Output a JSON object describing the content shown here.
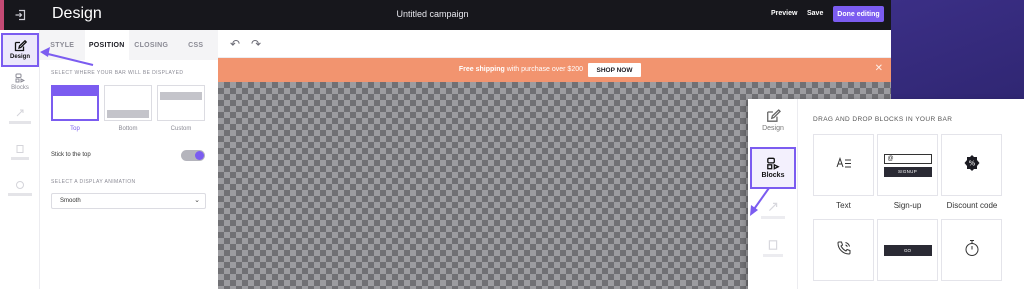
{
  "header": {
    "title": "Design",
    "campaign_name": "Untitled campaign",
    "preview_label": "Preview",
    "save_label": "Save",
    "done_label": "Done editing"
  },
  "left_rail": {
    "items": [
      {
        "label": "Design",
        "icon": "edit-icon",
        "active": true
      },
      {
        "label": "Blocks",
        "icon": "blocks-icon",
        "active": false
      }
    ]
  },
  "panel": {
    "tabs": [
      "STYLE",
      "POSITION",
      "CLOSING",
      "CSS"
    ],
    "active_tab": "POSITION",
    "position_label": "SELECT WHERE YOUR BAR WILL BE DISPLAYED",
    "position_options": [
      "Top",
      "Bottom",
      "Custom"
    ],
    "selected_position": "Top",
    "stick_label": "Stick to the top",
    "stick_enabled": true,
    "animation_label": "SELECT A DISPLAY ANIMATION",
    "animation_value": "Smooth"
  },
  "promo_bar": {
    "bold_text": "Free shipping",
    "text": " with purchase over $200",
    "button_label": "SHOP NOW",
    "background": "#f2946f"
  },
  "blocks_popup": {
    "rail": [
      {
        "label": "Design",
        "icon": "edit-icon"
      },
      {
        "label": "Blocks",
        "icon": "blocks-icon",
        "active": true
      }
    ],
    "heading": "DRAG AND DROP BLOCKS IN YOUR BAR",
    "blocks": [
      {
        "label": "Text",
        "icon": "text-icon"
      },
      {
        "label": "Sign-up",
        "icon": "signup-form-icon",
        "inner_button": "SIGNUP"
      },
      {
        "label": "Discount code",
        "icon": "discount-badge-icon"
      },
      {
        "label": "",
        "icon": "phone-call-icon"
      },
      {
        "label": "",
        "icon": "button-block-icon",
        "inner_button": "GO"
      },
      {
        "label": "",
        "icon": "timer-icon"
      }
    ]
  },
  "colors": {
    "accent": "#7b5cf0",
    "topbar": "#17171c",
    "promo": "#f2946f"
  }
}
